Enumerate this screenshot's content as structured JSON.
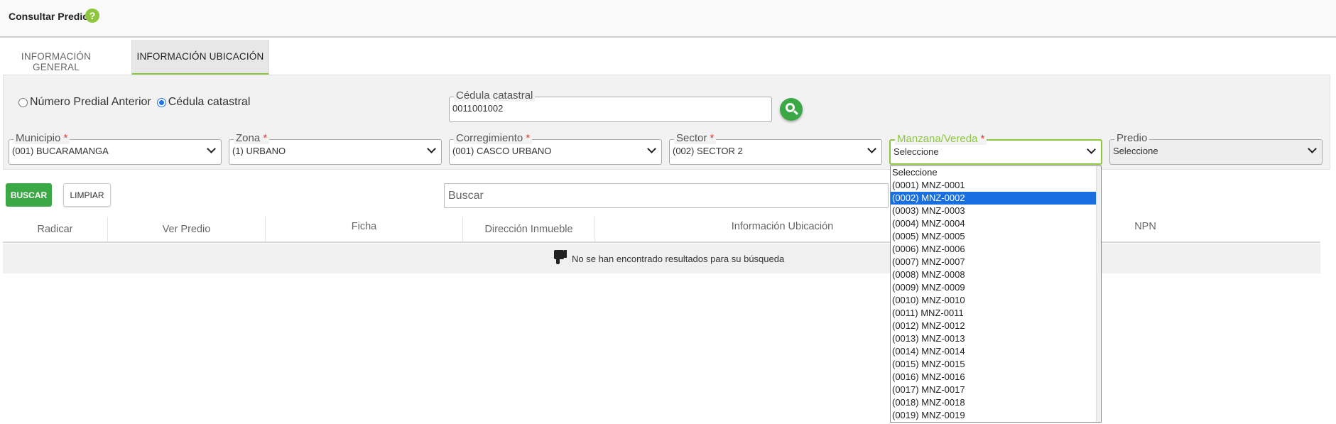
{
  "page": {
    "title": "Consultar Predio",
    "help_icon": "?"
  },
  "tabs": [
    {
      "label": "INFORMACIÓN GENERAL",
      "active": false
    },
    {
      "label": "INFORMACIÓN UBICACIÓN",
      "active": true
    }
  ],
  "radios": [
    {
      "label": "Número Predial Anterior",
      "checked": false
    },
    {
      "label": "Cédula catastral",
      "checked": true
    }
  ],
  "cedula": {
    "legend": "Cédula catastral",
    "value": "0011001002"
  },
  "filters": [
    {
      "legend": "Municipio",
      "required": "*",
      "value": "(001) BUCARAMANGA"
    },
    {
      "legend": "Zona",
      "required": "*",
      "value": "(1) URBANO"
    },
    {
      "legend": "Corregimiento",
      "required": "*",
      "value": "(001) CASCO URBANO"
    },
    {
      "legend": "Sector",
      "required": "*",
      "value": "(002) SECTOR 2"
    },
    {
      "legend": "Manzana/Vereda",
      "required": "*",
      "value": "Seleccione"
    },
    {
      "legend": "Predio",
      "required": "",
      "value": "Seleccione"
    }
  ],
  "actions": {
    "buscar": "BUSCAR",
    "limpiar": "LIMPIAR"
  },
  "search": {
    "placeholder": "Buscar"
  },
  "table": {
    "headers": [
      "Radicar",
      "Ver Predio",
      "Ficha",
      "Dirección Inmueble",
      "Información Ubicación",
      "NPN"
    ],
    "empty_message": "No se han encontrado resultados para su búsqueda"
  },
  "dropdown": {
    "options": [
      "Seleccione",
      "(0001) MNZ-0001",
      "(0002) MNZ-0002",
      "(0003) MNZ-0003",
      "(0004) MNZ-0004",
      "(0005) MNZ-0005",
      "(0006) MNZ-0006",
      "(0007) MNZ-0007",
      "(0008) MNZ-0008",
      "(0009) MNZ-0009",
      "(0010) MNZ-0010",
      "(0011) MNZ-0011",
      "(0012) MNZ-0012",
      "(0013) MNZ-0013",
      "(0014) MNZ-0014",
      "(0015) MNZ-0015",
      "(0016) MNZ-0016",
      "(0017) MNZ-0017",
      "(0018) MNZ-0018",
      "(0019) MNZ-0019"
    ],
    "highlighted": "(0002) MNZ-0002"
  },
  "colors": {
    "accent": "#8dc63f",
    "primary_button": "#3aa845",
    "highlight": "#1a6fe0",
    "required": "#e53935"
  }
}
